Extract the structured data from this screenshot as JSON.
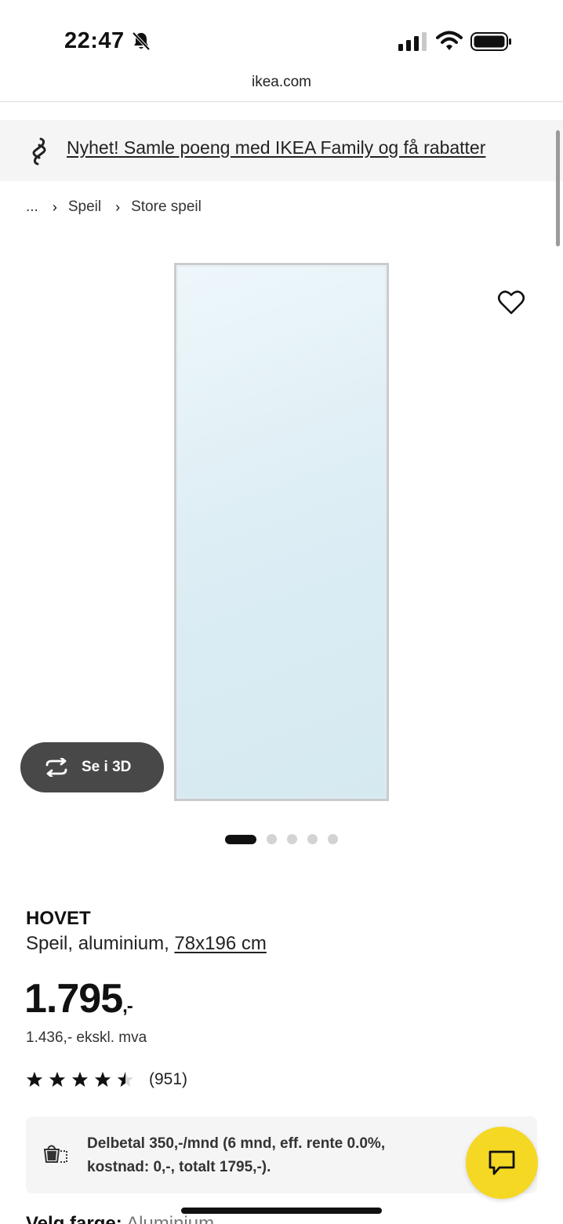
{
  "status_bar": {
    "time": "22:47",
    "icons": [
      "bell-muted-icon",
      "cellular-signal-icon",
      "wifi-icon",
      "battery-icon"
    ]
  },
  "browser": {
    "url": "ikea.com"
  },
  "promo": {
    "icon": "ikea-family-icon",
    "text": "Nyhet! Samle poeng med IKEA Family og få rabatter"
  },
  "breadcrumb": {
    "items": [
      "...",
      "Speil",
      "Store speil"
    ]
  },
  "media": {
    "see_3d_label": "Se i 3D",
    "carousel_total": 5,
    "carousel_active_index": 0
  },
  "product": {
    "name": "HOVET",
    "description": "Speil, aluminium, ",
    "size": "78x196 cm",
    "price": "1.795",
    "price_suffix": ",-",
    "price_excl_vat": "1.436,- ekskl. mva",
    "rating_value": 4.5,
    "rating_max": 5,
    "rating_count": "(951)"
  },
  "financing": {
    "line1": "Delbetal 350,-/mnd (6 mnd, eff. rente 0.0%,",
    "line2": "kostnad: 0,-, totalt 1795,-)."
  },
  "color_selector": {
    "label": "Velg farge:",
    "value": "Aluminium"
  },
  "colors": {
    "chat_button": "#f5d823",
    "see_3d_button": "#484848",
    "promo_bg": "#f5f5f5"
  }
}
